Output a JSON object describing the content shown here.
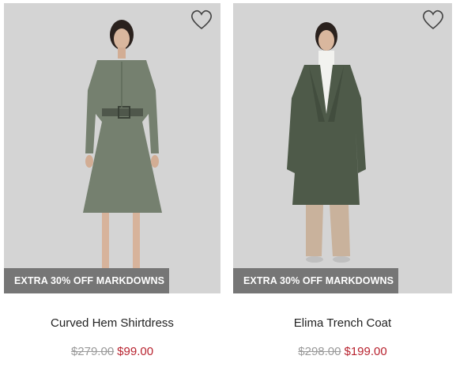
{
  "products": [
    {
      "name": "Curved Hem Shirtdress",
      "badge": "EXTRA 30% OFF MARKDOWNS",
      "old_price": "$279.00",
      "new_price": "$99.00",
      "wishlist_icon": "heart-outline-icon"
    },
    {
      "name": "Elima Trench Coat",
      "badge": "EXTRA 30% OFF MARKDOWNS",
      "old_price": "$298.00",
      "new_price": "$199.00",
      "wishlist_icon": "heart-outline-icon"
    }
  ],
  "colors": {
    "sale_price": "#b8232f",
    "old_price": "#9a9a9a",
    "badge_bg": "#6e6e6e",
    "photo_bg": "#d3d3d3"
  }
}
